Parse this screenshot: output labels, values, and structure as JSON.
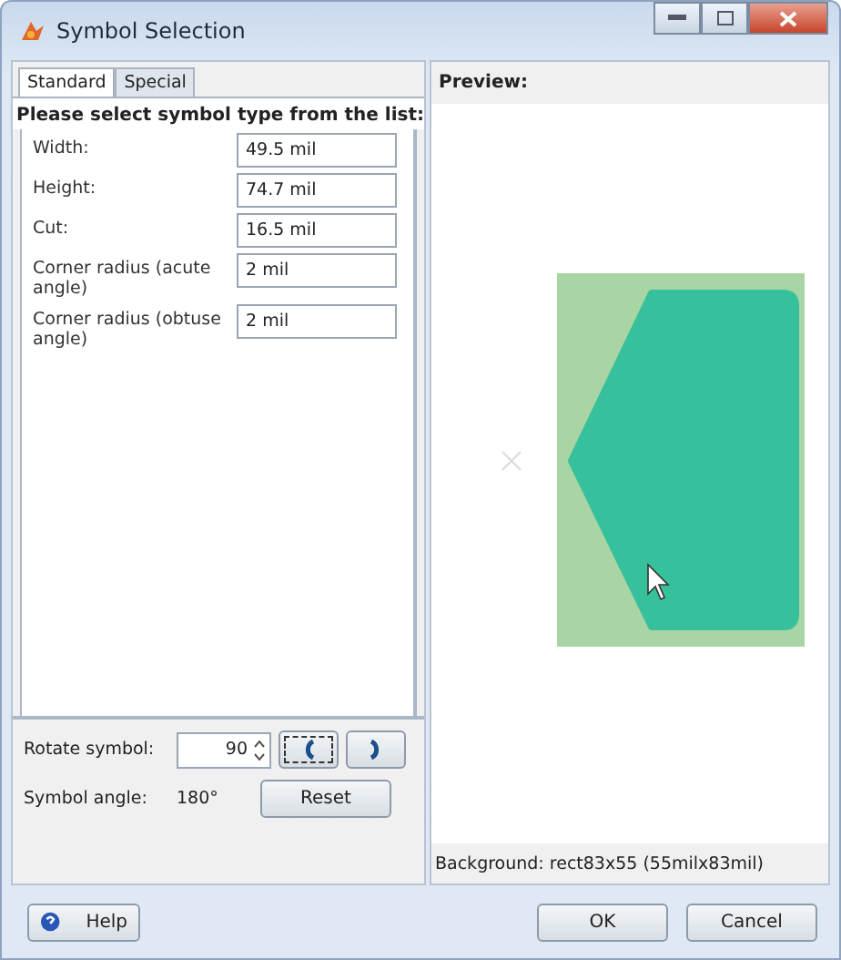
{
  "window": {
    "title": "Symbol Selection"
  },
  "tabs": [
    {
      "label": "Standard",
      "selected": true
    },
    {
      "label": "Special",
      "selected": false
    }
  ],
  "heading": "Please select symbol type from the list:",
  "fields": [
    {
      "label": "Width:",
      "value": "49.5 mil"
    },
    {
      "label": "Height:",
      "value": "74.7 mil"
    },
    {
      "label": "Cut:",
      "value": "16.5 mil"
    },
    {
      "label": "Corner radius (acute angle)",
      "value": "2 mil"
    },
    {
      "label": "Corner radius (obtuse angle)",
      "value": "2 mil"
    }
  ],
  "rotate": {
    "label": "Rotate symbol:",
    "value": "90",
    "buttons": [
      {
        "kind": "ccw",
        "focused": true
      },
      {
        "kind": "cw",
        "focused": false
      }
    ]
  },
  "angle": {
    "label": "Symbol angle:",
    "value": "180°"
  },
  "reset_button": "Reset",
  "preview": {
    "title": "Preview:",
    "status": "Background: rect83x55 (55milx83mil)"
  },
  "buttons": {
    "help": "Help",
    "ok": "OK",
    "cancel": "Cancel"
  }
}
